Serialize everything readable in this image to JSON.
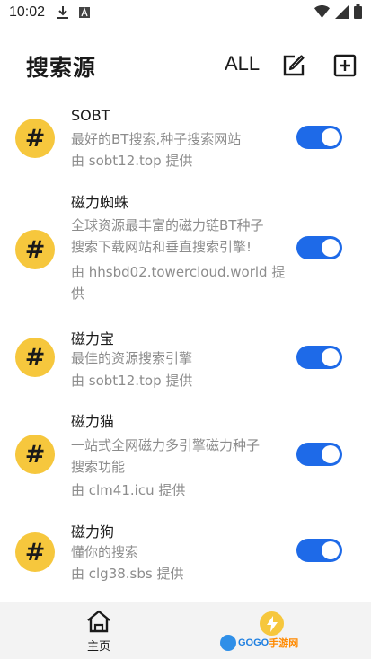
{
  "status_bar": {
    "time": "10:02",
    "icons": [
      "download-icon",
      "a-icon",
      "wifi-icon",
      "signal-icon",
      "battery-icon"
    ]
  },
  "header": {
    "title": "搜索源",
    "all_label": "ALL",
    "edit_icon": "edit-icon",
    "add_icon": "add-box-icon"
  },
  "sources": [
    {
      "avatar": "#",
      "name": "SOBT",
      "desc_lines": [
        "最好的BT搜索,种子搜索网站"
      ],
      "provider_lines": [
        "由 sobt12.top 提供"
      ],
      "enabled": true
    },
    {
      "avatar": "#",
      "name": "磁力蜘蛛",
      "desc_lines": [
        "全球资源最丰富的磁力链BT种子",
        "搜索下载网站和垂直搜索引擎!"
      ],
      "provider_lines": [
        "由 hhsbd02.towercloud.world 提",
        "供"
      ],
      "enabled": true
    },
    {
      "avatar": "#",
      "name": "磁力宝",
      "desc_lines": [
        "最佳的资源搜索引擎"
      ],
      "provider_lines": [
        "由 sobt12.top 提供"
      ],
      "enabled": true
    },
    {
      "avatar": "#",
      "name": "磁力猫",
      "desc_lines": [
        "一站式全网磁力多引擎磁力种子",
        "搜索功能"
      ],
      "provider_lines": [
        "由 clm41.icu 提供"
      ],
      "enabled": true
    },
    {
      "avatar": "#",
      "name": "磁力狗",
      "desc_lines": [
        "懂你的搜索"
      ],
      "provider_lines": [
        "由 clg38.sbs 提供"
      ],
      "enabled": true
    }
  ],
  "bottom_nav": {
    "home_label": "主页",
    "home_icon": "home-icon",
    "bolt_icon": "bolt-icon"
  },
  "watermark": {
    "part1": "GOGO",
    "part2": "手游网"
  },
  "colors": {
    "accent": "#1e6ae8",
    "avatar_bg": "#f6c73d",
    "secondary_text": "#8c8c8c"
  }
}
